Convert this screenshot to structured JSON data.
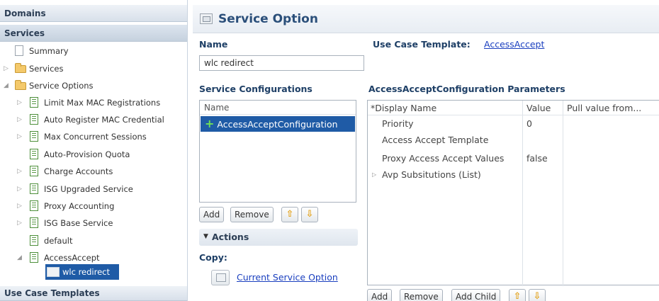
{
  "nav": {
    "domains_label": "Domains",
    "services_label": "Services",
    "use_case_templates_label": "Use Case Templates",
    "tree": [
      {
        "label": "Summary",
        "icon": "document-icon",
        "toggle": ""
      },
      {
        "label": "Services",
        "icon": "folder-icon",
        "toggle": "collapsed"
      },
      {
        "label": "Service Options",
        "icon": "folder-icon",
        "toggle": "expanded"
      },
      {
        "label": "Limit Max MAC Registrations",
        "icon": "list-icon",
        "toggle": "collapsed"
      },
      {
        "label": "Auto Register MAC Credential",
        "icon": "list-icon",
        "toggle": "collapsed"
      },
      {
        "label": "Max Concurrent Sessions",
        "icon": "list-icon",
        "toggle": "collapsed"
      },
      {
        "label": "Auto-Provision Quota",
        "icon": "list-icon",
        "toggle": ""
      },
      {
        "label": "Charge Accounts",
        "icon": "list-icon",
        "toggle": "collapsed"
      },
      {
        "label": "ISG Upgraded Service",
        "icon": "list-icon",
        "toggle": "collapsed"
      },
      {
        "label": "Proxy Accounting",
        "icon": "list-icon",
        "toggle": "collapsed"
      },
      {
        "label": "ISG Base Service",
        "icon": "list-icon",
        "toggle": "collapsed"
      },
      {
        "label": "default",
        "icon": "list-icon",
        "toggle": ""
      },
      {
        "label": "AccessAccept",
        "icon": "list-icon",
        "toggle": "expanded"
      },
      {
        "label": "wlc redirect",
        "icon": "service-option-icon",
        "toggle": "",
        "selected": true
      }
    ]
  },
  "editor": {
    "title": "Service Option",
    "name_label": "Name",
    "name_value": "wlc redirect",
    "use_case_template_label": "Use Case Template:",
    "use_case_template_link": "AccessAccept",
    "service_configurations_label": "Service Configurations",
    "config_column_header": "Name",
    "config_items": [
      "AccessAcceptConfiguration"
    ],
    "config_buttons": {
      "add": "Add",
      "remove": "Remove"
    },
    "params_title": "AccessAcceptConfiguration Parameters",
    "params_columns": [
      "*Display Name",
      "Value",
      "Pull value from..."
    ],
    "params_rows": [
      {
        "name": "Priority",
        "value": "0"
      },
      {
        "name": "Access Accept Template",
        "value": ""
      },
      {
        "name": "Proxy Access Accept Values",
        "value": "false"
      },
      {
        "name": "Avp Subsitutions (List)",
        "value": ""
      }
    ],
    "params_buttons": {
      "add": "Add",
      "remove": "Remove",
      "add_child": "Add Child"
    },
    "actions_title": "Actions",
    "copy_label": "Copy:",
    "copy_link": "Current Service Option"
  },
  "colors": {
    "selection": "#1f5ba6",
    "link": "#1a3fbf",
    "section_label": "#1e3f66"
  }
}
